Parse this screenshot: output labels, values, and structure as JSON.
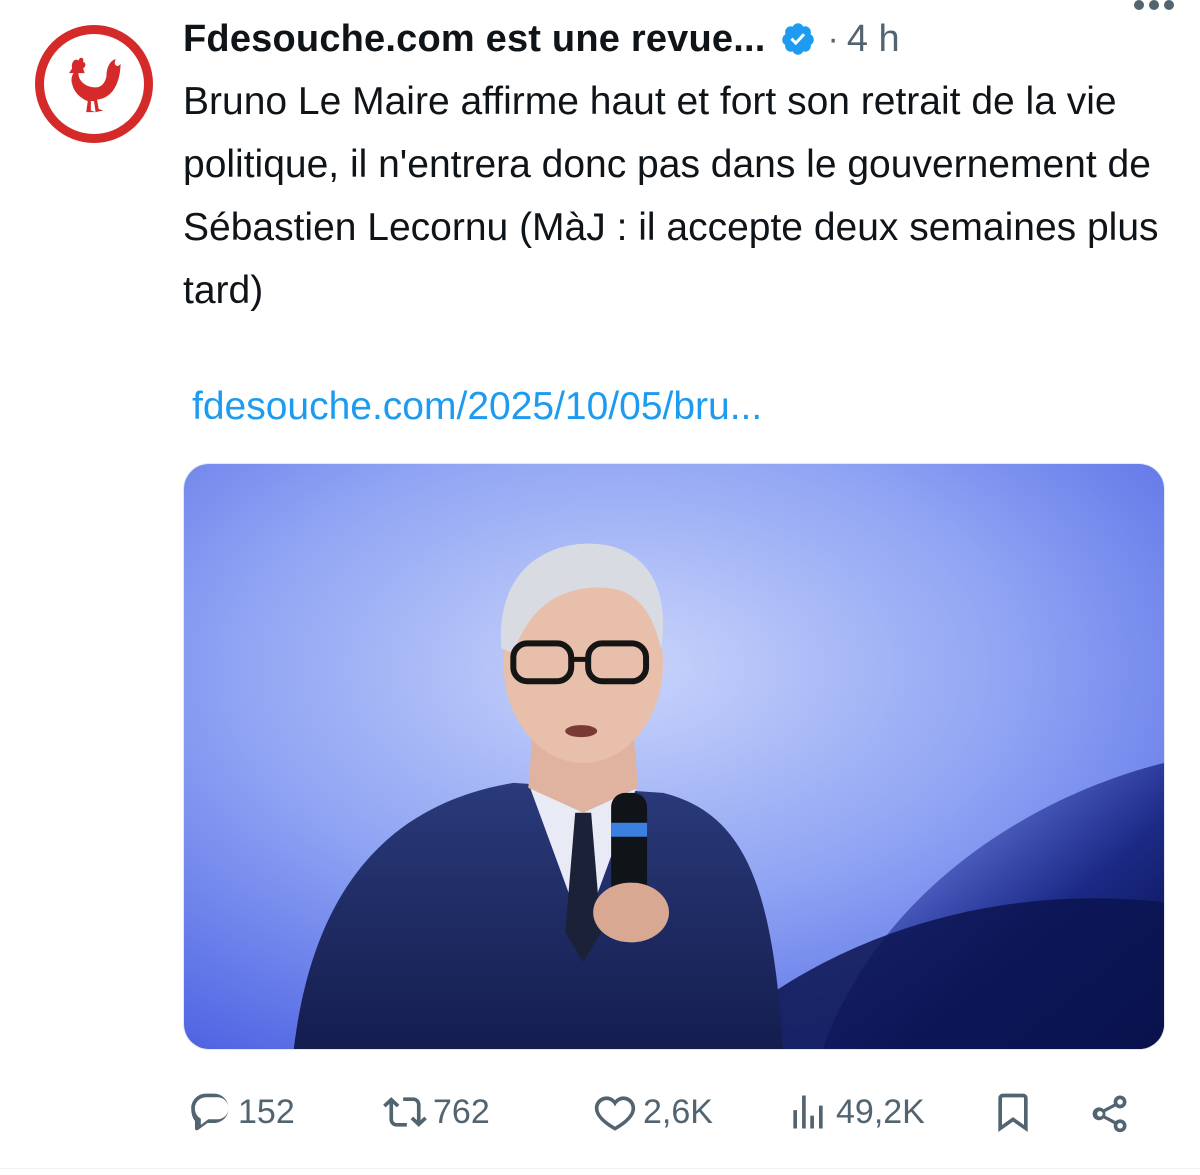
{
  "tweet": {
    "author": {
      "display_name": "Fdesouche.com est une revue...",
      "verified": true,
      "avatar_icon": "rooster-logo-icon",
      "avatar_color": "#d42a2a"
    },
    "separator": "·",
    "timestamp": "4 h",
    "text": "Bruno Le Maire affirme haut et fort son retrait de la vie politique, il n'entrera donc pas dans le gouvernement de Sébastien Lecornu (MàJ : il accepte deux semaines plus tard)",
    "link_text": "fdesouche.com/2025/10/05/bru...",
    "media_icon": "photo-speaker-icon",
    "actions": {
      "replies": "152",
      "reposts": "762",
      "likes": "2,6K",
      "views": "49,2K"
    }
  },
  "colors": {
    "text": "#0f1419",
    "secondary": "#536471",
    "link": "#1d9bf0",
    "verified": "#1d9bf0"
  }
}
